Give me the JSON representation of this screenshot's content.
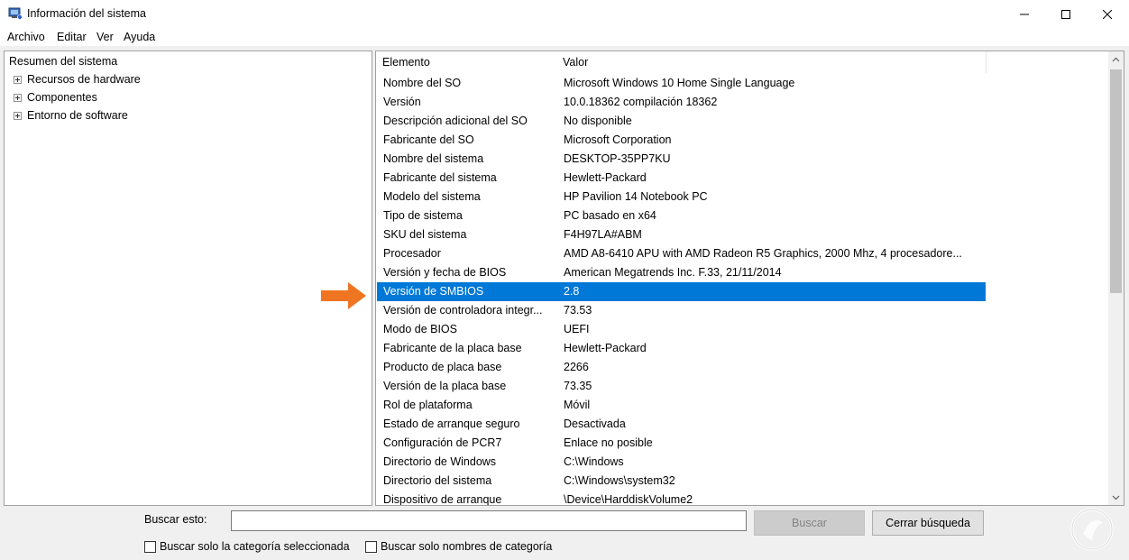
{
  "window": {
    "title": "Información del sistema",
    "minimize_symbol": "—",
    "maximize_symbol": "☐",
    "close_symbol": "✕"
  },
  "menu": [
    "Archivo",
    "Editar",
    "Ver",
    "Ayuda"
  ],
  "tree": {
    "root": "Resumen del sistema",
    "children": [
      "Recursos de hardware",
      "Componentes",
      "Entorno de software"
    ]
  },
  "list": {
    "headers": [
      "Elemento",
      "Valor"
    ],
    "rows": [
      {
        "item": "Nombre del SO",
        "value": "Microsoft Windows 10 Home Single Language"
      },
      {
        "item": "Versión",
        "value": "10.0.18362 compilación 18362"
      },
      {
        "item": "Descripción adicional del SO",
        "value": "No disponible"
      },
      {
        "item": "Fabricante del SO",
        "value": "Microsoft Corporation"
      },
      {
        "item": "Nombre del sistema",
        "value": "DESKTOP-35PP7KU"
      },
      {
        "item": "Fabricante del sistema",
        "value": "Hewlett-Packard"
      },
      {
        "item": "Modelo del sistema",
        "value": "HP Pavilion 14 Notebook PC"
      },
      {
        "item": "Tipo de sistema",
        "value": "PC basado en x64"
      },
      {
        "item": "SKU del sistema",
        "value": "F4H97LA#ABM"
      },
      {
        "item": "Procesador",
        "value": "AMD A8-6410 APU with AMD Radeon R5 Graphics, 2000 Mhz, 4 procesadore..."
      },
      {
        "item": "Versión y fecha de BIOS",
        "value": "American Megatrends Inc. F.33, 21/11/2014"
      },
      {
        "item": "Versión de SMBIOS",
        "value": "2.8",
        "selected": true
      },
      {
        "item": "Versión de controladora integr...",
        "value": "73.53"
      },
      {
        "item": "Modo de BIOS",
        "value": "UEFI"
      },
      {
        "item": "Fabricante de la placa base",
        "value": "Hewlett-Packard"
      },
      {
        "item": "Producto de placa base",
        "value": "2266"
      },
      {
        "item": "Versión de la placa base",
        "value": "73.35"
      },
      {
        "item": "Rol de plataforma",
        "value": "Móvil"
      },
      {
        "item": "Estado de arranque seguro",
        "value": "Desactivada"
      },
      {
        "item": "Configuración de PCR7",
        "value": "Enlace no posible"
      },
      {
        "item": "Directorio de Windows",
        "value": "C:\\Windows"
      },
      {
        "item": "Directorio del sistema",
        "value": "C:\\Windows\\system32"
      },
      {
        "item": "Dispositivo de arranque",
        "value": "\\Device\\HarddiskVolume2"
      }
    ]
  },
  "search": {
    "label": "Buscar esto:",
    "value": "",
    "search_button": "Buscar",
    "clear_button": "Cerrar búsqueda",
    "checkbox_category": "Buscar solo la categoría seleccionada",
    "checkbox_names": "Buscar solo nombres de categoría"
  },
  "colors": {
    "selection": "#0078d7",
    "annotation_arrow": "#f07522"
  },
  "icons": {
    "app": "system-info-icon",
    "annotation": "orange-arrow-icon",
    "watermark": "watermark-logo"
  }
}
